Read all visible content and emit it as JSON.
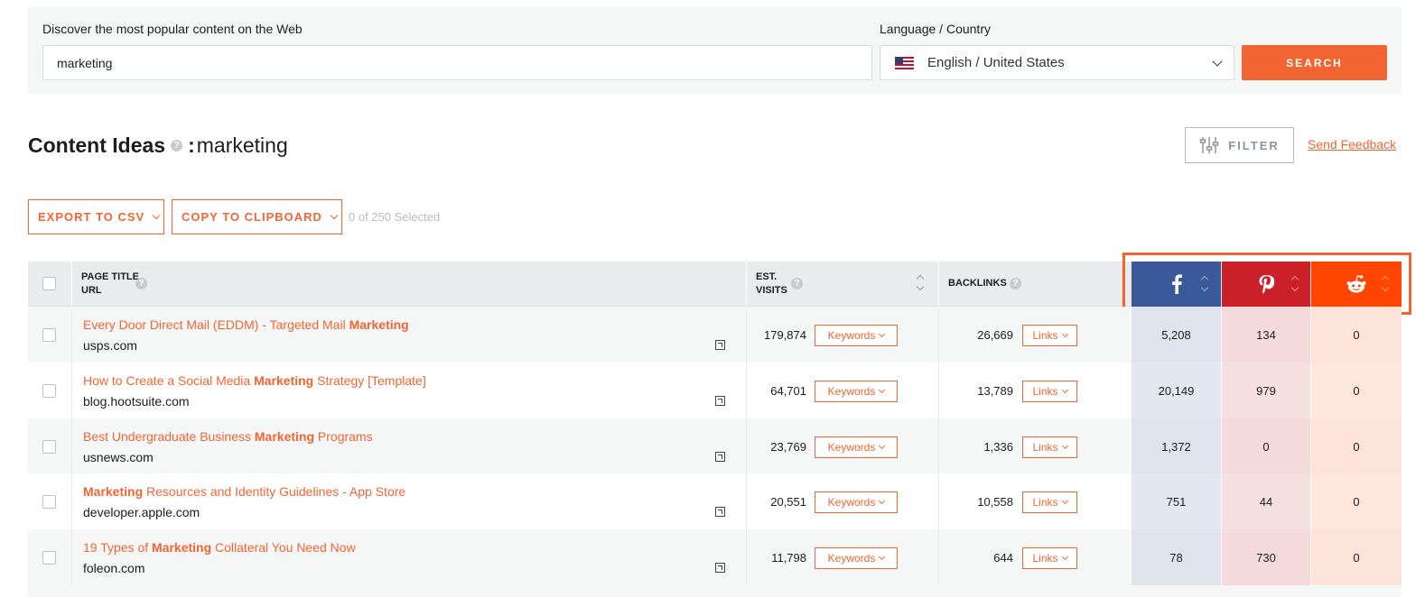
{
  "search": {
    "discover_label": "Discover the most popular content on the Web",
    "query": "marketing",
    "lang_label": "Language / Country",
    "lang_value": "English / United States",
    "search_button": "SEARCH"
  },
  "header": {
    "title": "Content Ideas",
    "help_glyph": "?",
    "separator": ":",
    "keyword": "marketing",
    "filter_label": "FILTER",
    "feedback_label": "Send Feedback"
  },
  "actions": {
    "export_label": "EXPORT TO CSV",
    "copy_label": "COPY TO CLIPBOARD",
    "selected_text": "0 of 250 Selected"
  },
  "table": {
    "col_title": "PAGE TITLE",
    "col_url": "URL",
    "col_visits_1": "EST.",
    "col_visits_2": "VISITS",
    "col_backlinks": "BACKLINKS",
    "keywords_label": "Keywords",
    "links_label": "Links",
    "social": {
      "facebook_color": "#3b5998",
      "pinterest_color": "#cb2027",
      "reddit_color": "#ff4500"
    },
    "rows": [
      {
        "title_pre": "Every Door Direct Mail (EDDM) - Targeted Mail ",
        "title_bold": "Marketing",
        "title_post": "",
        "domain": "usps.com",
        "visits": "179,874",
        "backlinks": "26,669",
        "facebook": "5,208",
        "pinterest": "134",
        "reddit": "0"
      },
      {
        "title_pre": "How to Create a Social Media ",
        "title_bold": "Marketing",
        "title_post": " Strategy [Template]",
        "domain": "blog.hootsuite.com",
        "visits": "64,701",
        "backlinks": "13,789",
        "facebook": "20,149",
        "pinterest": "979",
        "reddit": "0"
      },
      {
        "title_pre": "Best Undergraduate Business ",
        "title_bold": "Marketing",
        "title_post": " Programs",
        "domain": "usnews.com",
        "visits": "23,769",
        "backlinks": "1,336",
        "facebook": "1,372",
        "pinterest": "0",
        "reddit": "0"
      },
      {
        "title_pre": "",
        "title_bold": "Marketing",
        "title_post": " Resources and Identity Guidelines - App Store",
        "domain": "developer.apple.com",
        "visits": "20,551",
        "backlinks": "10,558",
        "facebook": "751",
        "pinterest": "44",
        "reddit": "0"
      },
      {
        "title_pre": "19 Types of ",
        "title_bold": "Marketing",
        "title_post": " Collateral You Need Now",
        "domain": "foleon.com",
        "visits": "11,798",
        "backlinks": "644",
        "facebook": "78",
        "pinterest": "730",
        "reddit": "0"
      }
    ]
  }
}
